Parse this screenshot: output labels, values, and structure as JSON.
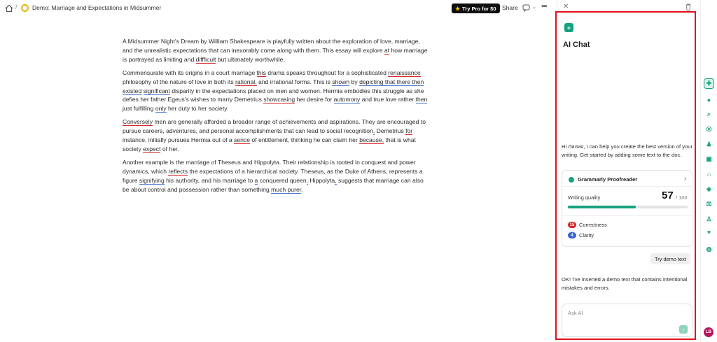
{
  "header": {
    "doc_title": "Demo: Marriage and Expectations in Midsummer",
    "try_pro_label": "Try Pro for $0",
    "share_label": "Share"
  },
  "document": {
    "p1": {
      "t1": "A Midsummer Night's Dream by William Shakespeare is playfully written about the exploration of love, marriage, and the unrealistic expectations that can inexorably come along with them. This essay will explore ",
      "u1": "at",
      "t2": " how marriage is portrayed as limiting and ",
      "u2": "diffficult",
      "t3": " but ultimately worthwhile."
    },
    "p2": {
      "t1": "Commensurate with its origins in a court marriage ",
      "u1": "this",
      "t2": " drama speaks throughout for a sophisticated ",
      "u2": "renaissance",
      "t3": " philosophy of the nature of love in both its ",
      "u3": "rational,",
      "t4": " and irrational forms. This is ",
      "u4": "shown",
      "t5": " by ",
      "u5": "depicting that there then existed",
      "t6": " ",
      "u6": "significant",
      "t7": " disparity in the expectations placed on men and women. Hermia embodies this struggle as she defies her father Egeus's wishes to marry Demetrius ",
      "u7": "showcasing",
      "t8": " her desire for ",
      "u8": "automony",
      "t9": " and true love rather ",
      "u9": "then",
      "t10": " just fulfilling ",
      "u10": "only",
      "t11": " her duty to her society."
    },
    "p3": {
      "u1": "Conversely",
      "t1": " men are generally afforded a broader range of achievements and aspirations. They are encouraged to pursue careers, adventures, and personal accomplishments that can lead to social recognition",
      "u2": ".",
      "t2": " Demetrius ",
      "u3": "for",
      "t3": " instance, initially pursues Hermia out of a ",
      "u4": "sence",
      "t4": " of entitlement, thinking he can claim her ",
      "u5": "because,",
      "t5": " that is what society ",
      "u6": "expect",
      "t6": " of her."
    },
    "p4": {
      "t1": "Another example is the marriage of Theseus and Hippolyta. Their relationship is rooted in conquest and power dynamics, which ",
      "u1": "reflects",
      "t2": " the expectations of a hierarchical society. Theseus, as the Duke of Athens, represents a figure ",
      "u2": "signifying",
      "t3": " his authority, and his marriage to ",
      "u3": "a",
      "t4": " conquered queen",
      "u4": ",",
      "t5": " Hippolyta",
      "u5": ",",
      "t6": " suggests that marriage can also be about control and possession rather than something ",
      "u6": "much purer",
      "t7": "."
    }
  },
  "ai_panel": {
    "title": "AI Chat",
    "greeting": "Hi Лилия, I can help you create the best version of your writing. Get started by adding some text to the doc.",
    "proofreader": {
      "title": "Grammarly Proofreader",
      "quality_label": "Writing quality",
      "score": "57",
      "total": "/ 100",
      "score_fraction": 0.57,
      "correctness_count": "15",
      "correctness_label": "Correctness",
      "clarity_count": "4",
      "clarity_label": "Clarity"
    },
    "try_demo_label": "Try demo text",
    "ok_message": "OK! I've inserted a demo text that contains intentional mistakes and errors.",
    "ask_placeholder": "Ask AI"
  },
  "avatar_initials": "LB",
  "colors": {
    "accent": "#15a37f",
    "error_underline": "#d8262a",
    "clarity_underline": "#4a78d1",
    "panel_outline": "#e3111a"
  }
}
